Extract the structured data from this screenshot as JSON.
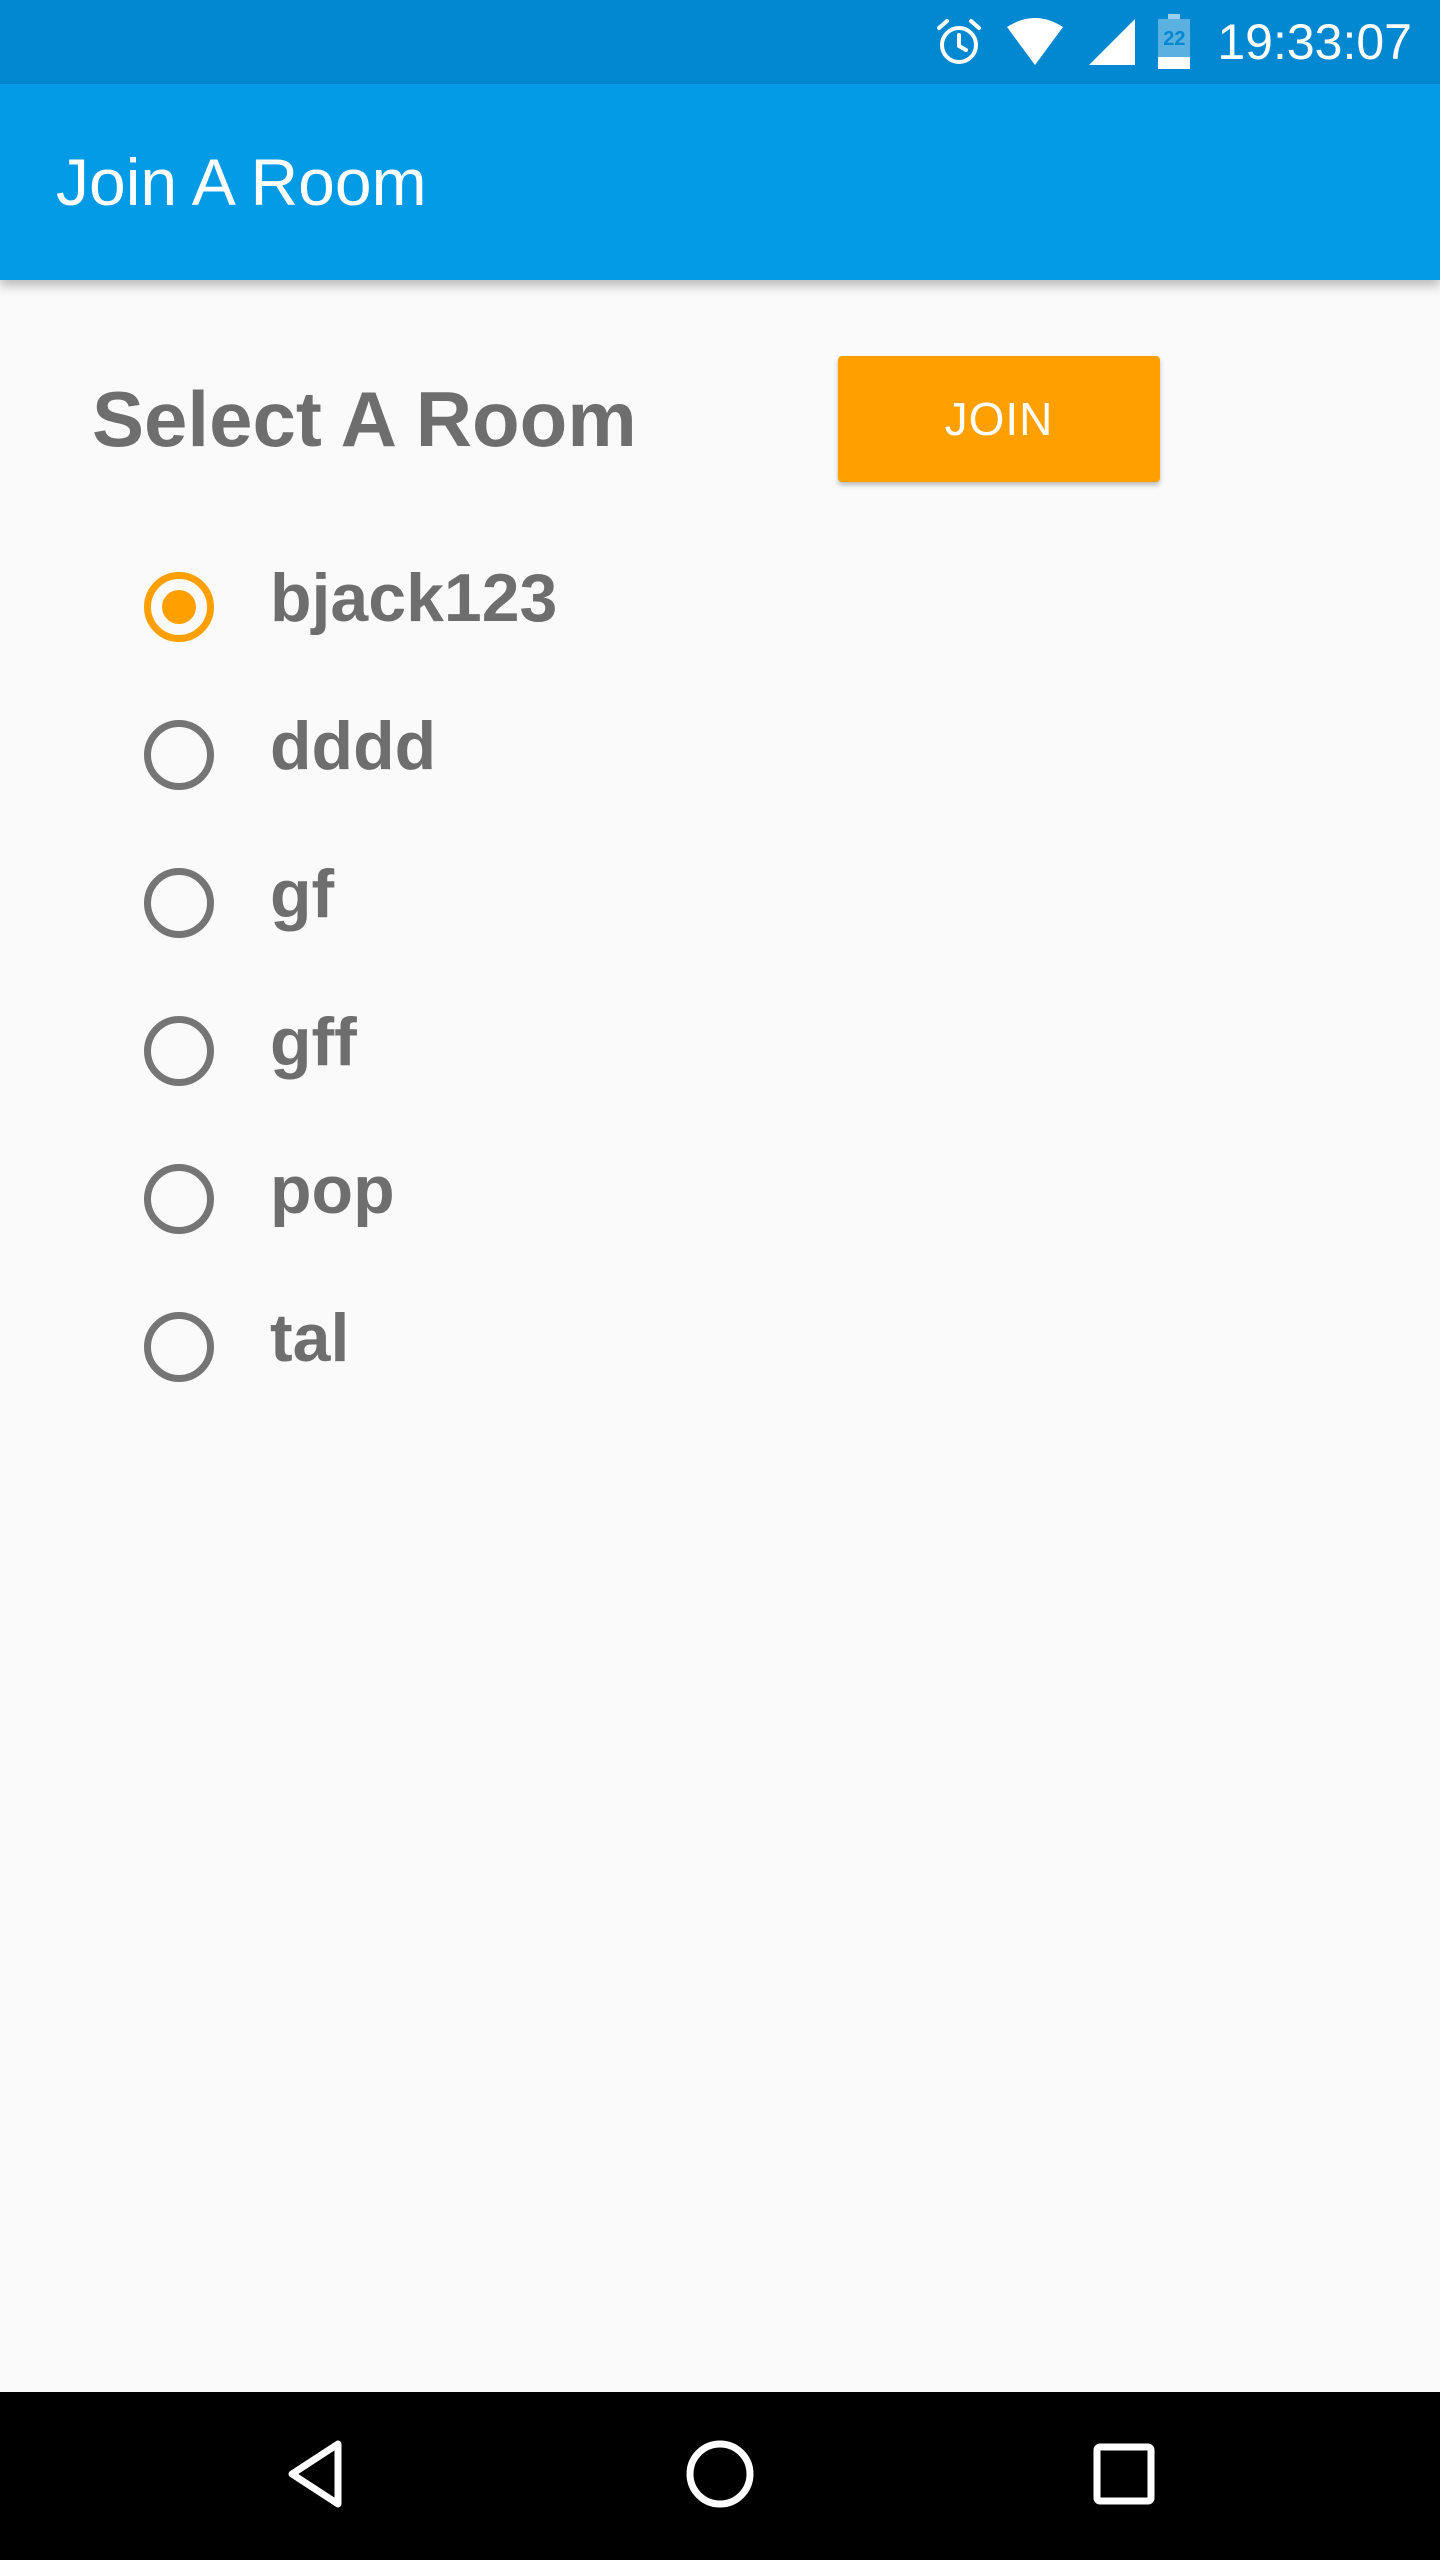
{
  "status_bar": {
    "time": "19:33:07",
    "battery_level": "22",
    "icons": [
      "alarm-icon",
      "wifi-icon",
      "signal-icon",
      "battery-icon"
    ]
  },
  "app_bar": {
    "title": "Join A Room"
  },
  "main": {
    "section_title": "Select A Room",
    "join_label": "JOIN",
    "rooms": [
      {
        "label": "bjack123",
        "selected": true
      },
      {
        "label": "dddd",
        "selected": false
      },
      {
        "label": "gf",
        "selected": false
      },
      {
        "label": "gff",
        "selected": false
      },
      {
        "label": "pop",
        "selected": false
      },
      {
        "label": "tal",
        "selected": false
      }
    ]
  },
  "nav_bar": {
    "icons": [
      "back-icon",
      "home-icon",
      "recents-icon"
    ]
  },
  "colors": {
    "status_bar": "#0288d1",
    "app_bar": "#039be5",
    "accent": "#ffa000",
    "text_secondary": "#6e6e6e",
    "background": "#fafafa"
  }
}
